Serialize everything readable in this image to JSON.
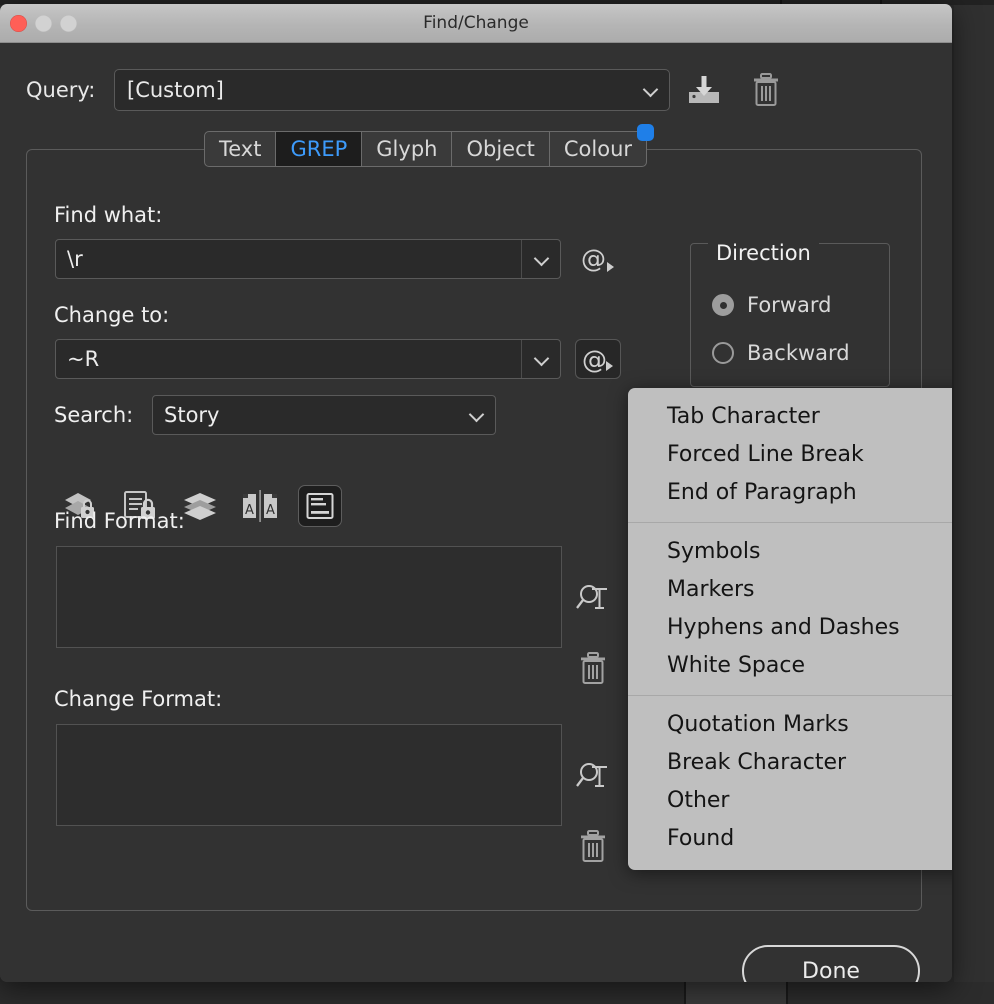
{
  "window": {
    "title": "Find/Change",
    "traffic_lights": [
      "close-button",
      "minimize-button",
      "zoom-button"
    ]
  },
  "query": {
    "label": "Query:",
    "value": "[Custom]",
    "save_icon": "save-query-icon",
    "delete_icon": "delete-query-icon"
  },
  "tabs": [
    {
      "label": "Text",
      "active": false
    },
    {
      "label": "GREP",
      "active": true
    },
    {
      "label": "Glyph",
      "active": false
    },
    {
      "label": "Object",
      "active": false
    },
    {
      "label": "Colour",
      "active": false,
      "badge": true
    }
  ],
  "form": {
    "find_what_label": "Find what:",
    "find_what_value": "\\r",
    "change_to_label": "Change to:",
    "change_to_value": "~R",
    "search_label": "Search:",
    "search_value": "Story",
    "find_format_label": "Find Format:",
    "find_format_value": "",
    "change_format_label": "Change Format:",
    "change_format_value": "",
    "at_button_label": "@"
  },
  "direction": {
    "title": "Direction",
    "options": [
      {
        "label": "Forward",
        "selected": true
      },
      {
        "label": "Backward",
        "selected": false
      }
    ]
  },
  "toolbar_icons": [
    {
      "name": "include-locked-layers-icon",
      "on": false
    },
    {
      "name": "include-locked-stories-icon",
      "on": false
    },
    {
      "name": "include-hidden-layers-icon",
      "on": false
    },
    {
      "name": "case-sensitive-icon",
      "on": false
    },
    {
      "name": "include-footnotes-icon",
      "on": true
    }
  ],
  "footer": {
    "done_label": "Done"
  },
  "menu": {
    "sections": [
      [
        "Tab Character",
        "Forced Line Break",
        "End of Paragraph"
      ],
      [
        "Symbols",
        "Markers",
        "Hyphens and Dashes",
        "White Space"
      ],
      [
        "Quotation Marks",
        "Break Character",
        "Other",
        "Found"
      ]
    ]
  },
  "colors": {
    "accent_blue": "#3d9bfb",
    "badge_blue": "#1f7fe8",
    "dialog_bg": "#323232",
    "field_bg": "#2a2a2a",
    "menu_bg": "#bfbfbf",
    "close_red": "#ff5f57"
  }
}
